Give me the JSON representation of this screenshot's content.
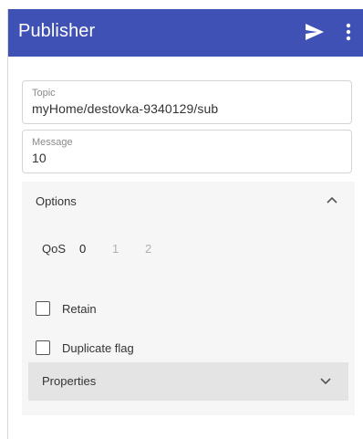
{
  "appbar": {
    "title": "Publisher",
    "send_icon": "send-icon",
    "more_icon": "more-vert-icon",
    "color": "#3f51b5"
  },
  "topic": {
    "label": "Topic",
    "value": "myHome/destovka-9340129/sub"
  },
  "message": {
    "label": "Message",
    "value": "10"
  },
  "options": {
    "title": "Options",
    "expanded": true,
    "qos": {
      "label": "QoS",
      "values": [
        "0",
        "1",
        "2"
      ],
      "selected": "0"
    },
    "retain": {
      "label": "Retain",
      "checked": false
    },
    "duplicate": {
      "label": "Duplicate flag",
      "checked": false
    },
    "properties": {
      "title": "Properties",
      "expanded": false
    }
  }
}
